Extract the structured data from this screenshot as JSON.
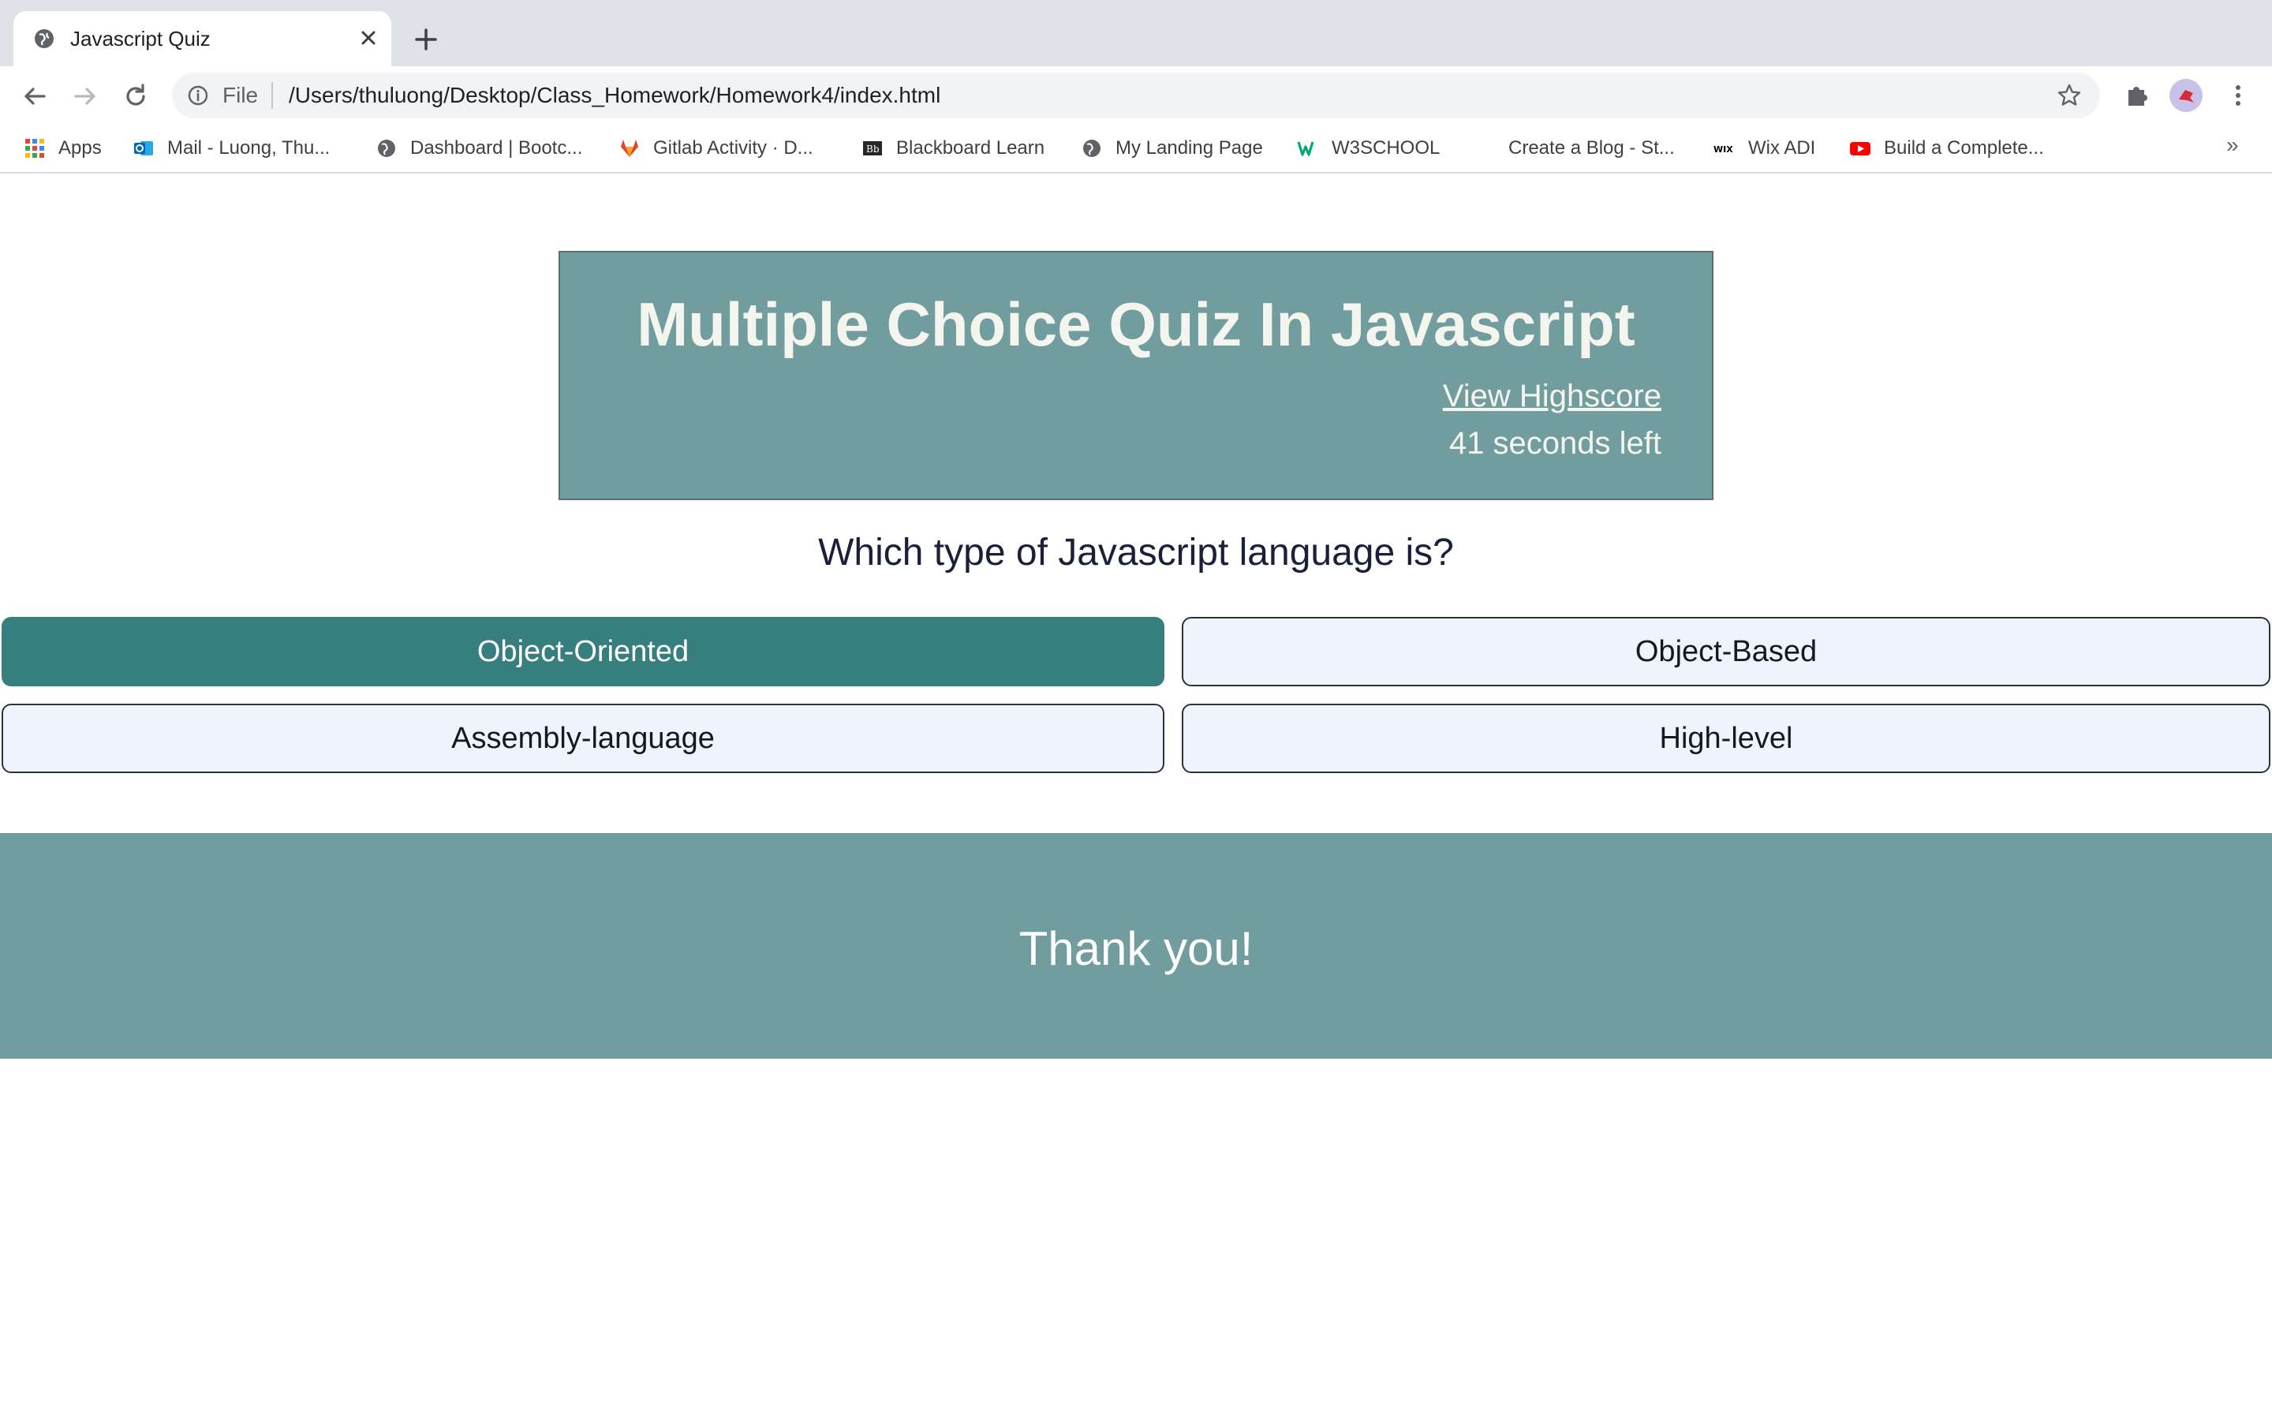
{
  "browser": {
    "tab": {
      "title": "Javascript Quiz",
      "favicon": "globe-icon"
    },
    "new_tab_icon": "plus-icon",
    "toolbar": {
      "scheme_label": "File",
      "url": "/Users/thuluong/Desktop/Class_Homework/Homework4/index.html"
    },
    "bookmarks": [
      {
        "label": "Apps",
        "icon": "apps-grid-icon"
      },
      {
        "label": "Mail - Luong, Thu...",
        "icon": "outlook-icon"
      },
      {
        "label": "Dashboard | Bootc...",
        "icon": "globe-icon"
      },
      {
        "label": "Gitlab Activity · D...",
        "icon": "gitlab-icon"
      },
      {
        "label": "Blackboard Learn",
        "icon": "blackboard-icon"
      },
      {
        "label": "My Landing Page",
        "icon": "globe-icon"
      },
      {
        "label": "W3SCHOOL",
        "icon": "w3schools-icon"
      },
      {
        "label": "Create a Blog - St...",
        "icon": "blank-icon"
      },
      {
        "label": "Wix ADI",
        "icon": "wix-icon"
      },
      {
        "label": "Build a Complete...",
        "icon": "youtube-icon"
      }
    ],
    "bookmarks_overflow": "»"
  },
  "quiz": {
    "title": "Multiple Choice Quiz In Javascript",
    "highscore_link": "View Highscore",
    "timer": "41 seconds left",
    "question": "Which type of Javascript language is?",
    "answers": [
      {
        "label": "Object-Oriented",
        "selected": true
      },
      {
        "label": "Object-Based",
        "selected": false
      },
      {
        "label": "Assembly-language",
        "selected": false
      },
      {
        "label": "High-level",
        "selected": false
      }
    ]
  },
  "footer": {
    "text": "Thank you!"
  },
  "colors": {
    "header_bg": "#719d9e",
    "selected_answer": "#367f7e",
    "answer_bg": "#eef3fd",
    "question_text": "#1c1f3a"
  }
}
